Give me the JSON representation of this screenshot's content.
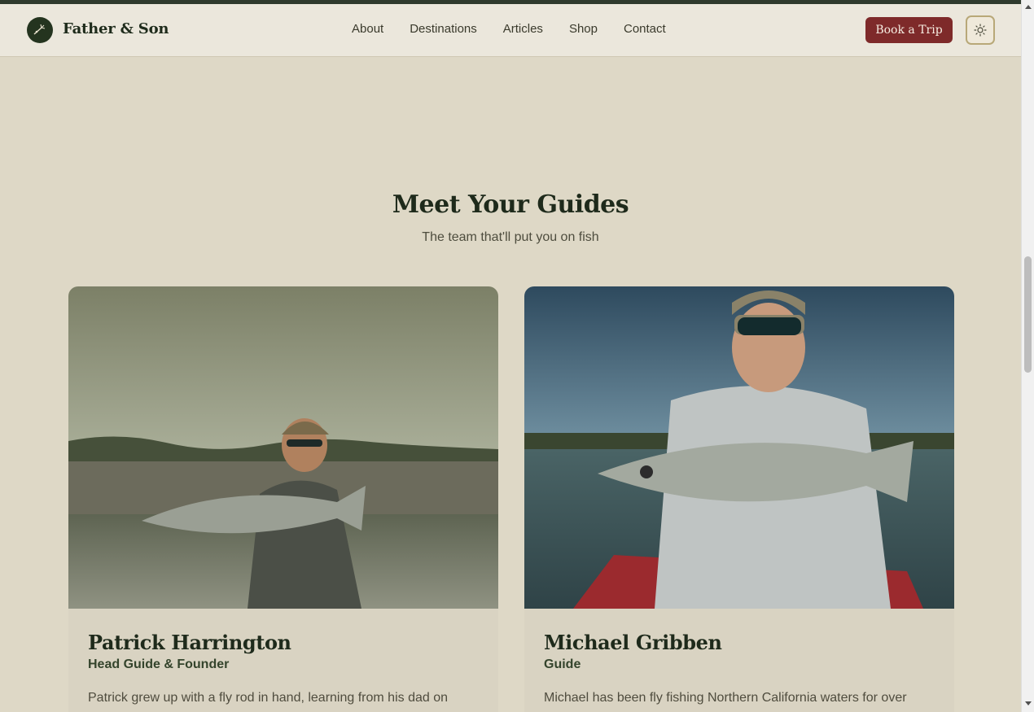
{
  "header": {
    "brand": "Father & Son",
    "nav": [
      "About",
      "Destinations",
      "Articles",
      "Shop",
      "Contact"
    ],
    "cta_label": "Book a Trip",
    "theme_icon": "sun-icon"
  },
  "guides_section": {
    "title": "Meet Your Guides",
    "subtitle": "The team that'll put you on fish",
    "guides": [
      {
        "name": "Patrick Harrington",
        "role": "Head Guide & Founder",
        "bio": "Patrick grew up with a fly rod in hand, learning from his dad on"
      },
      {
        "name": "Michael Gribben",
        "role": "Guide",
        "bio": "Michael has been fly fishing Northern California waters for over"
      }
    ]
  },
  "colors": {
    "page_bg": "#ded8c6",
    "header_bg": "#ebe7dc",
    "brand_dark": "#24341f",
    "cta_red": "#7e2a2a",
    "accent_gold": "#b8a878"
  }
}
